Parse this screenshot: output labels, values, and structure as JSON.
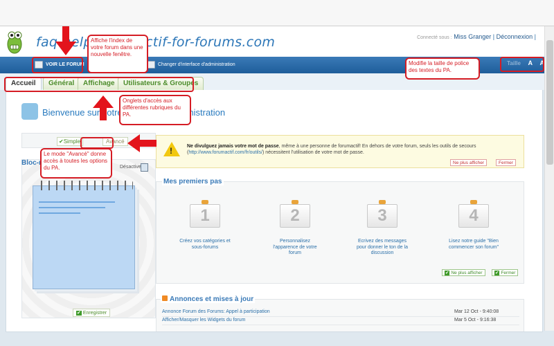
{
  "header": {
    "title": "faq-help-forumactif-for-forums.com",
    "connected_label": "Connecté sous :",
    "user": "Miss Granger",
    "logout": "Déconnexion"
  },
  "nav": {
    "view_forum": "VOIR LE FORUM",
    "switch_admin": "Changer d'interface d'administration",
    "font_reset": "Taille",
    "font_smaller": "A",
    "font_larger": "A"
  },
  "tabs": [
    {
      "label": "Accueil",
      "active": true
    },
    {
      "label": "Général",
      "active": false
    },
    {
      "label": "Affichage",
      "active": false
    },
    {
      "label": "Utilisateurs & Groupes",
      "active": false
    }
  ],
  "welcome": {
    "prefix": "Bienvenue sur",
    "middle": "votre panneau d'",
    "suffix": "administration"
  },
  "mode": {
    "simple": "Simple",
    "advanced": "Avancé"
  },
  "bloc": {
    "title": "Bloc-notes",
    "deactivate": "Désactiver",
    "save": "Enregistrer"
  },
  "warning": {
    "bold": "Ne divulguez jamais votre mot de passe",
    "text1": ", même à une personne de forumactif! En dehors de votre forum, seuls les outils de secours (",
    "link": "http://www.forumactif.com/fr/outils/",
    "text2": ") nécessitent l'utilisation de votre mot de passe.",
    "hide": "Ne plus afficher",
    "close": "Fermer"
  },
  "steps": {
    "title": "Mes premiers pas",
    "items": [
      {
        "num": "1",
        "label": "Créez vos catégories et sous-forums"
      },
      {
        "num": "2",
        "label": "Personnalisez l'apparence de votre forum"
      },
      {
        "num": "3",
        "label": "Ecrivez des messages pour donner le ton de la discussion"
      },
      {
        "num": "4",
        "label": "Lisez notre guide \"Bien commencer son forum\""
      }
    ],
    "hide": "Ne plus afficher",
    "close": "Fermer"
  },
  "announcements": {
    "title": "Annonces et mises à jour",
    "rows": [
      {
        "text": "Annonce Forum des Forums: Appel à participation",
        "date": "Mar 12 Oct - 9:40:08"
      },
      {
        "text": "Afficher/Masquer les Widgets du forum",
        "date": "Mar 5 Oct - 9:16:38"
      }
    ]
  },
  "callouts": {
    "view_forum": "Affiche l'index de votre forum dans une nouvelle fenêtre.",
    "font_size": "Modifie la taille de police des textes du PA.",
    "tabs": "Onglets d'accès aux différentes rubriques du PA.",
    "advanced": "Le mode \"Avancé\" donne accès à toutes les options du PA."
  },
  "colors": {
    "brand_blue": "#2d77b8",
    "nav_bar": "#1e5d9a",
    "tab_green": "#4c8c2a",
    "annotation_red": "#d51c24",
    "warning_bg": "#fdfbe1"
  }
}
